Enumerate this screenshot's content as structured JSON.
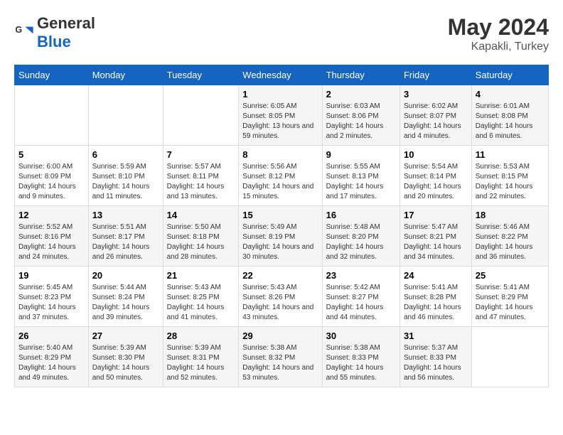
{
  "header": {
    "logo_general": "General",
    "logo_blue": "Blue",
    "title": "May 2024",
    "subtitle": "Kapakli, Turkey"
  },
  "days_of_week": [
    "Sunday",
    "Monday",
    "Tuesday",
    "Wednesday",
    "Thursday",
    "Friday",
    "Saturday"
  ],
  "weeks": [
    [
      {
        "day": "",
        "info": ""
      },
      {
        "day": "",
        "info": ""
      },
      {
        "day": "",
        "info": ""
      },
      {
        "day": "1",
        "info": "Sunrise: 6:05 AM\nSunset: 8:05 PM\nDaylight: 13 hours and 59 minutes."
      },
      {
        "day": "2",
        "info": "Sunrise: 6:03 AM\nSunset: 8:06 PM\nDaylight: 14 hours and 2 minutes."
      },
      {
        "day": "3",
        "info": "Sunrise: 6:02 AM\nSunset: 8:07 PM\nDaylight: 14 hours and 4 minutes."
      },
      {
        "day": "4",
        "info": "Sunrise: 6:01 AM\nSunset: 8:08 PM\nDaylight: 14 hours and 6 minutes."
      }
    ],
    [
      {
        "day": "5",
        "info": "Sunrise: 6:00 AM\nSunset: 8:09 PM\nDaylight: 14 hours and 9 minutes."
      },
      {
        "day": "6",
        "info": "Sunrise: 5:59 AM\nSunset: 8:10 PM\nDaylight: 14 hours and 11 minutes."
      },
      {
        "day": "7",
        "info": "Sunrise: 5:57 AM\nSunset: 8:11 PM\nDaylight: 14 hours and 13 minutes."
      },
      {
        "day": "8",
        "info": "Sunrise: 5:56 AM\nSunset: 8:12 PM\nDaylight: 14 hours and 15 minutes."
      },
      {
        "day": "9",
        "info": "Sunrise: 5:55 AM\nSunset: 8:13 PM\nDaylight: 14 hours and 17 minutes."
      },
      {
        "day": "10",
        "info": "Sunrise: 5:54 AM\nSunset: 8:14 PM\nDaylight: 14 hours and 20 minutes."
      },
      {
        "day": "11",
        "info": "Sunrise: 5:53 AM\nSunset: 8:15 PM\nDaylight: 14 hours and 22 minutes."
      }
    ],
    [
      {
        "day": "12",
        "info": "Sunrise: 5:52 AM\nSunset: 8:16 PM\nDaylight: 14 hours and 24 minutes."
      },
      {
        "day": "13",
        "info": "Sunrise: 5:51 AM\nSunset: 8:17 PM\nDaylight: 14 hours and 26 minutes."
      },
      {
        "day": "14",
        "info": "Sunrise: 5:50 AM\nSunset: 8:18 PM\nDaylight: 14 hours and 28 minutes."
      },
      {
        "day": "15",
        "info": "Sunrise: 5:49 AM\nSunset: 8:19 PM\nDaylight: 14 hours and 30 minutes."
      },
      {
        "day": "16",
        "info": "Sunrise: 5:48 AM\nSunset: 8:20 PM\nDaylight: 14 hours and 32 minutes."
      },
      {
        "day": "17",
        "info": "Sunrise: 5:47 AM\nSunset: 8:21 PM\nDaylight: 14 hours and 34 minutes."
      },
      {
        "day": "18",
        "info": "Sunrise: 5:46 AM\nSunset: 8:22 PM\nDaylight: 14 hours and 36 minutes."
      }
    ],
    [
      {
        "day": "19",
        "info": "Sunrise: 5:45 AM\nSunset: 8:23 PM\nDaylight: 14 hours and 37 minutes."
      },
      {
        "day": "20",
        "info": "Sunrise: 5:44 AM\nSunset: 8:24 PM\nDaylight: 14 hours and 39 minutes."
      },
      {
        "day": "21",
        "info": "Sunrise: 5:43 AM\nSunset: 8:25 PM\nDaylight: 14 hours and 41 minutes."
      },
      {
        "day": "22",
        "info": "Sunrise: 5:43 AM\nSunset: 8:26 PM\nDaylight: 14 hours and 43 minutes."
      },
      {
        "day": "23",
        "info": "Sunrise: 5:42 AM\nSunset: 8:27 PM\nDaylight: 14 hours and 44 minutes."
      },
      {
        "day": "24",
        "info": "Sunrise: 5:41 AM\nSunset: 8:28 PM\nDaylight: 14 hours and 46 minutes."
      },
      {
        "day": "25",
        "info": "Sunrise: 5:41 AM\nSunset: 8:29 PM\nDaylight: 14 hours and 47 minutes."
      }
    ],
    [
      {
        "day": "26",
        "info": "Sunrise: 5:40 AM\nSunset: 8:29 PM\nDaylight: 14 hours and 49 minutes."
      },
      {
        "day": "27",
        "info": "Sunrise: 5:39 AM\nSunset: 8:30 PM\nDaylight: 14 hours and 50 minutes."
      },
      {
        "day": "28",
        "info": "Sunrise: 5:39 AM\nSunset: 8:31 PM\nDaylight: 14 hours and 52 minutes."
      },
      {
        "day": "29",
        "info": "Sunrise: 5:38 AM\nSunset: 8:32 PM\nDaylight: 14 hours and 53 minutes."
      },
      {
        "day": "30",
        "info": "Sunrise: 5:38 AM\nSunset: 8:33 PM\nDaylight: 14 hours and 55 minutes."
      },
      {
        "day": "31",
        "info": "Sunrise: 5:37 AM\nSunset: 8:33 PM\nDaylight: 14 hours and 56 minutes."
      },
      {
        "day": "",
        "info": ""
      }
    ]
  ]
}
